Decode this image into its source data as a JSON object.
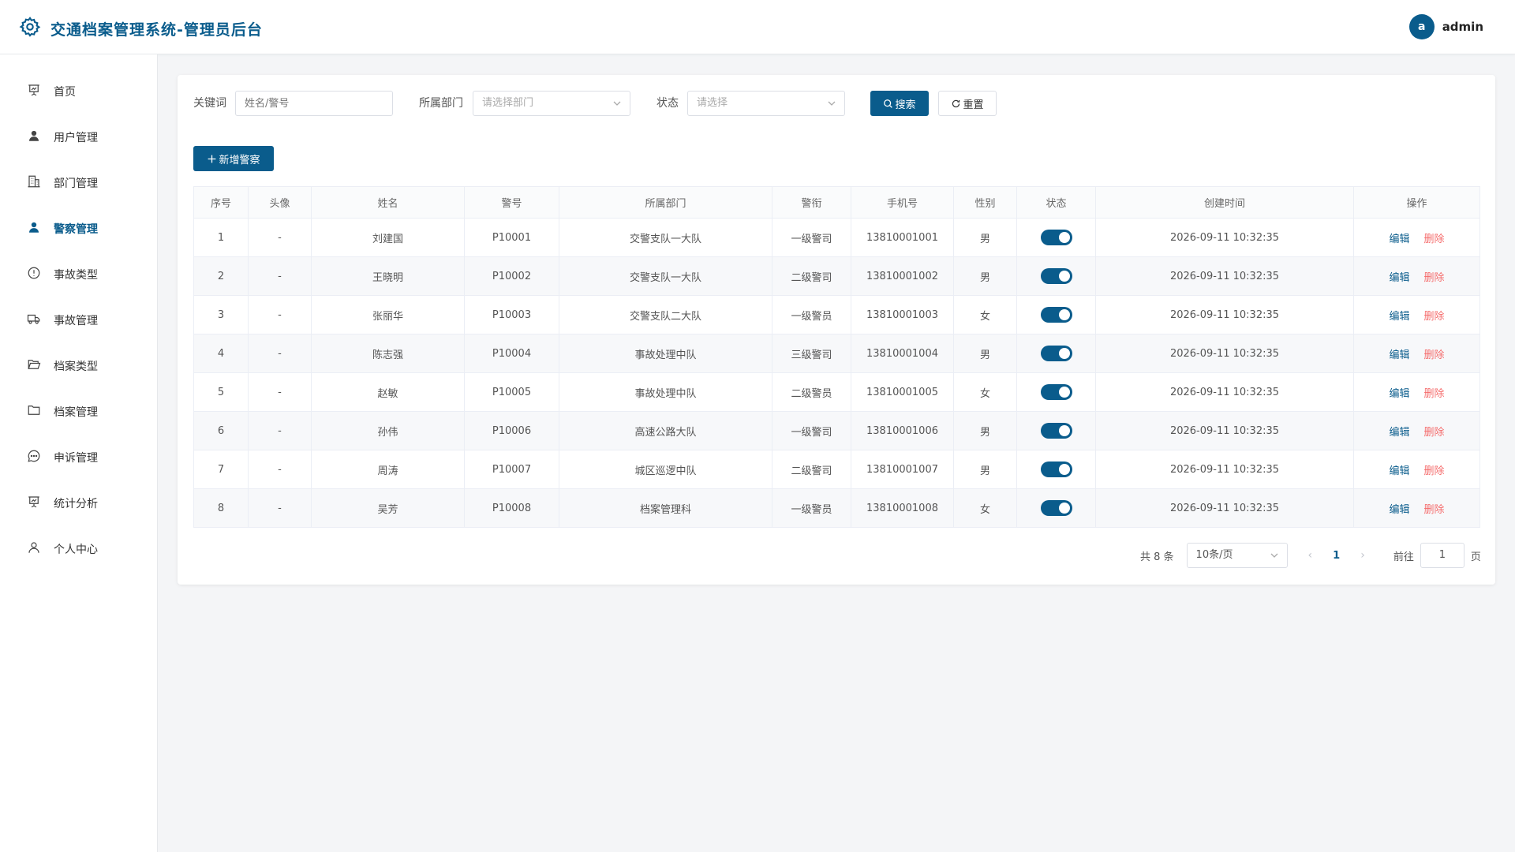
{
  "header": {
    "title": "交通档案管理系统-管理员后台",
    "user": {
      "avatar_letter": "a",
      "name": "admin"
    }
  },
  "sidebar": {
    "items": [
      {
        "label": "首页",
        "icon": "presentation-icon",
        "active": false
      },
      {
        "label": "用户管理",
        "icon": "user-filled-icon",
        "active": false
      },
      {
        "label": "部门管理",
        "icon": "building-icon",
        "active": false
      },
      {
        "label": "警察管理",
        "icon": "user-filled-icon",
        "active": true
      },
      {
        "label": "事故类型",
        "icon": "warning-circle-icon",
        "active": false
      },
      {
        "label": "事故管理",
        "icon": "truck-icon",
        "active": false
      },
      {
        "label": "档案类型",
        "icon": "folder-open-icon",
        "active": false
      },
      {
        "label": "档案管理",
        "icon": "folder-icon",
        "active": false
      },
      {
        "label": "申诉管理",
        "icon": "chat-dots-icon",
        "active": false
      },
      {
        "label": "统计分析",
        "icon": "data-board-icon",
        "active": false
      },
      {
        "label": "个人中心",
        "icon": "user-outline-icon",
        "active": false
      }
    ]
  },
  "filters": {
    "keyword_label": "关键词",
    "keyword_placeholder": "姓名/警号",
    "dept_label": "所属部门",
    "dept_placeholder": "请选择部门",
    "status_label": "状态",
    "status_placeholder": "请选择",
    "search_label": "搜索",
    "reset_label": "重置"
  },
  "add_button": "新增警察",
  "table": {
    "columns": [
      "序号",
      "头像",
      "姓名",
      "警号",
      "所属部门",
      "警衔",
      "手机号",
      "性别",
      "状态",
      "创建时间",
      "操作"
    ],
    "edit_label": "编辑",
    "delete_label": "删除",
    "rows": [
      {
        "idx": "1",
        "avatar": "-",
        "name": "刘建国",
        "badge": "P10001",
        "dept": "交警支队一大队",
        "rank": "一级警司",
        "phone": "13810001001",
        "gender": "男",
        "enabled": true,
        "created": "2026-09-11 10:32:35"
      },
      {
        "idx": "2",
        "avatar": "-",
        "name": "王晓明",
        "badge": "P10002",
        "dept": "交警支队一大队",
        "rank": "二级警司",
        "phone": "13810001002",
        "gender": "男",
        "enabled": true,
        "created": "2026-09-11 10:32:35"
      },
      {
        "idx": "3",
        "avatar": "-",
        "name": "张丽华",
        "badge": "P10003",
        "dept": "交警支队二大队",
        "rank": "一级警员",
        "phone": "13810001003",
        "gender": "女",
        "enabled": true,
        "created": "2026-09-11 10:32:35"
      },
      {
        "idx": "4",
        "avatar": "-",
        "name": "陈志强",
        "badge": "P10004",
        "dept": "事故处理中队",
        "rank": "三级警司",
        "phone": "13810001004",
        "gender": "男",
        "enabled": true,
        "created": "2026-09-11 10:32:35"
      },
      {
        "idx": "5",
        "avatar": "-",
        "name": "赵敏",
        "badge": "P10005",
        "dept": "事故处理中队",
        "rank": "二级警员",
        "phone": "13810001005",
        "gender": "女",
        "enabled": true,
        "created": "2026-09-11 10:32:35"
      },
      {
        "idx": "6",
        "avatar": "-",
        "name": "孙伟",
        "badge": "P10006",
        "dept": "高速公路大队",
        "rank": "一级警司",
        "phone": "13810001006",
        "gender": "男",
        "enabled": true,
        "created": "2026-09-11 10:32:35"
      },
      {
        "idx": "7",
        "avatar": "-",
        "name": "周涛",
        "badge": "P10007",
        "dept": "城区巡逻中队",
        "rank": "二级警司",
        "phone": "13810001007",
        "gender": "男",
        "enabled": true,
        "created": "2026-09-11 10:32:35"
      },
      {
        "idx": "8",
        "avatar": "-",
        "name": "吴芳",
        "badge": "P10008",
        "dept": "档案管理科",
        "rank": "一级警员",
        "phone": "13810001008",
        "gender": "女",
        "enabled": true,
        "created": "2026-09-11 10:32:35"
      }
    ]
  },
  "pagination": {
    "total_text": "共 8 条",
    "page_size": "10条/页",
    "current_page": "1",
    "goto_label": "前往",
    "goto_value": "1",
    "page_unit": "页"
  },
  "colors": {
    "primary": "#0a5c8c",
    "danger": "#f56c6c"
  }
}
